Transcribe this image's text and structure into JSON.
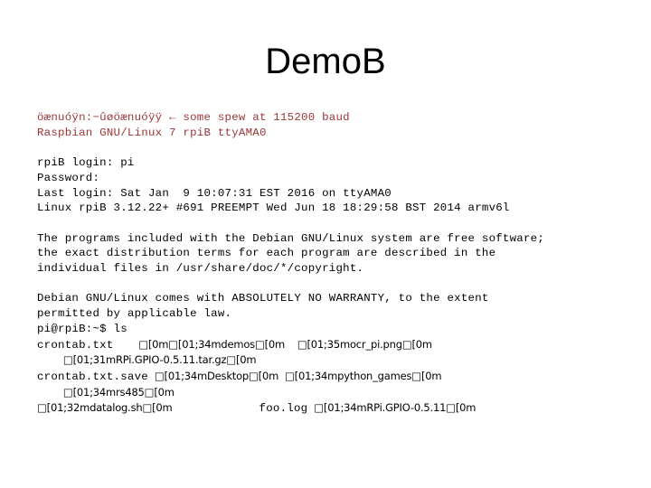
{
  "slide": {
    "title": "DemoB",
    "background_color": "#ffffff",
    "title_color": "#000000"
  },
  "console": {
    "boot_color": "#9c3434",
    "text_color": "#000000",
    "lines": [
      {
        "id": "boot-garble",
        "color": "red",
        "text": "öænuóÿn:−ûøöænuóÿÿ ← some spew at 115200 baud"
      },
      {
        "id": "os-banner",
        "color": "red",
        "text": "Raspbian GNU/Linux 7 rpiB ttyAMA0"
      },
      {
        "id": "login-prompt",
        "color": "black",
        "text": "rpiB login: pi"
      },
      {
        "id": "password-prompt",
        "color": "black",
        "text": "Password:"
      },
      {
        "id": "last-login",
        "color": "black",
        "text": "Last login: Sat Jan  9 10:07:31 EST 2016 on ttyAMA0"
      },
      {
        "id": "kernel-banner",
        "color": "black",
        "text": "Linux rpiB 3.12.22+ #691 PREEMPT Wed Jun 18 18:29:58 BST 2014 armv6l"
      },
      {
        "id": "copyright-1",
        "color": "black",
        "text": "The programs included with the Debian GNU/Linux system are free software;"
      },
      {
        "id": "copyright-2",
        "color": "black",
        "text": "the exact distribution terms for each program are described in the"
      },
      {
        "id": "copyright-3",
        "color": "black",
        "text": "individual files in /usr/share/doc/*/copyright."
      },
      {
        "id": "warranty-1",
        "color": "black",
        "text": "Debian GNU/Linux comes with ABSOLUTELY NO WARRANTY, to the extent"
      },
      {
        "id": "warranty-2",
        "color": "black",
        "text": "permitted by applicable law."
      },
      {
        "id": "shell-prompt-ls",
        "color": "black",
        "text": "pi@rpiB:~$ ls"
      }
    ],
    "ls_output": {
      "rows": [
        {
          "id": "ls-row-1",
          "plain": "crontab.txt",
          "escapes": "        □[0m□[01;34mdemos□[0m    □[01;35mocr_pi.png□[0m"
        },
        {
          "id": "ls-row-1-cont",
          "plain": "",
          "escapes": "  □[01;31mRPi.GPIO-0.5.11.tar.gz□[0m"
        },
        {
          "id": "ls-row-2",
          "plain": "crontab.txt.save",
          "escapes": "  □[01;34mDesktop□[0m  □[01;34mpython_games□[0m"
        },
        {
          "id": "ls-row-2-cont",
          "plain": "",
          "escapes": "  □[01;34mrs485□[0m"
        },
        {
          "id": "ls-row-3",
          "plain": "",
          "escapes": "□[01;32mdatalog.sh□[0m"
        },
        {
          "id": "ls-row-3-tail",
          "plain": "foo.log",
          "escapes": "  □[01;34mRPi.GPIO-0.5.11□[0m"
        }
      ]
    }
  }
}
